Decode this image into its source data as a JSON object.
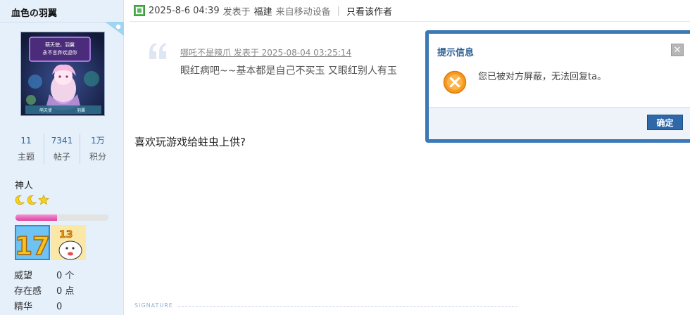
{
  "sidebar": {
    "username": "血色の羽翼",
    "avatar_text": [
      "萌天使，羽翼",
      "永不言弃欢迎你"
    ],
    "avatar_footer": [
      "萌天使",
      "羽翼"
    ],
    "stats": [
      {
        "value": "11",
        "label": "主题"
      },
      {
        "value": "7341",
        "label": "帖子"
      },
      {
        "value": "1万",
        "label": "积分"
      }
    ],
    "rank": "神人",
    "rank_progress": 0.45,
    "medals": [
      "17",
      "13"
    ],
    "meta": [
      {
        "key": "威望",
        "value": "0 个"
      },
      {
        "key": "存在感",
        "value": "0 点"
      },
      {
        "key": "精华",
        "value": "0"
      }
    ]
  },
  "post": {
    "date": "2025-8-6 04:39",
    "posted_in": "发表于",
    "location": "福建",
    "device": "来自移动设备",
    "only_author": "只看该作者",
    "quote_meta": "哪吒不是辣爪 发表于 2025-08-04 03:25:14",
    "quote_body": "眼红病吧~~基本都是自己不买玉 又眼红别人有玉",
    "body": "喜欢玩游戏给蛀虫上供?",
    "signature_label": "SIGNATURE"
  },
  "modal": {
    "title": "提示信息",
    "message": "您已被对方屏蔽，无法回复ta。",
    "ok_label": "确定"
  },
  "colors": {
    "sidebar_bg": "#e6f0fb",
    "modal_border": "#3a78b6",
    "button_bg": "#2f68a8",
    "stat_number": "#336699",
    "progress_fill": "#e0409f"
  }
}
